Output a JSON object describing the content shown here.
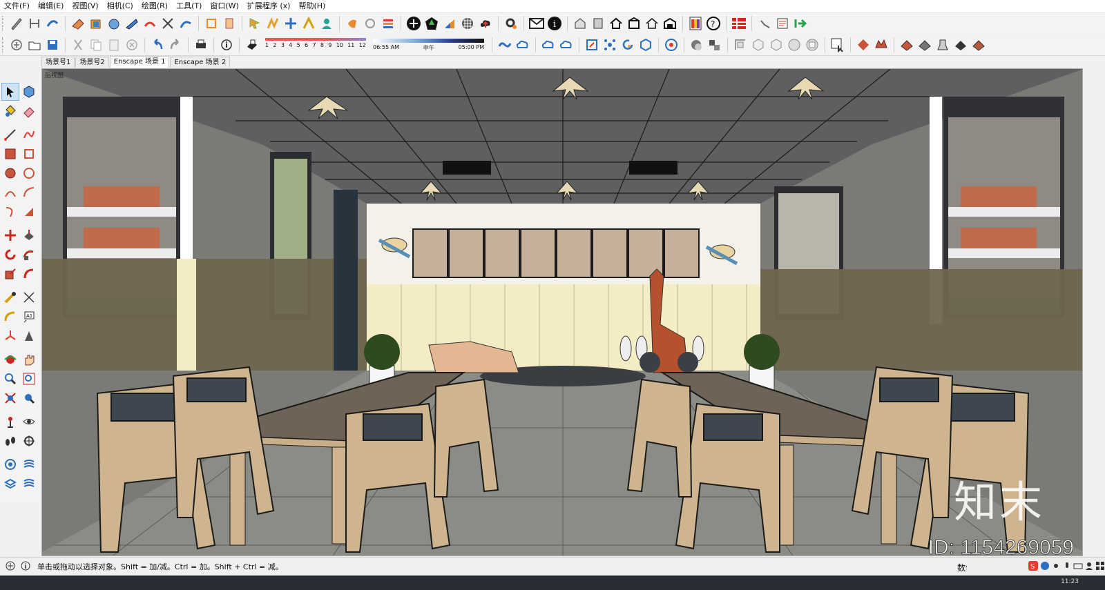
{
  "menu": [
    "文件(F)",
    "编辑(E)",
    "视图(V)",
    "相机(C)",
    "绘图(R)",
    "工具(T)",
    "窗口(W)",
    "扩展程序 (x)",
    "帮助(H)"
  ],
  "shadow": {
    "months": [
      "1",
      "2",
      "3",
      "4",
      "5",
      "6",
      "7",
      "8",
      "9",
      "10",
      "11",
      "12"
    ],
    "time_start": "06:55 AM",
    "time_mid": "中午",
    "time_end": "05:00 PM"
  },
  "scenes": [
    "场景号1",
    "场景号2",
    "Enscape 场景 1",
    "Enscape 场景 2"
  ],
  "active_scene_index": 2,
  "viewport": {
    "view_label": "后视图"
  },
  "watermark": {
    "logo": "知末",
    "id": "ID: 1154269059"
  },
  "status": {
    "hint": "单击或拖动以选择对象。Shift = 加/减。Ctrl = 加。Shift + Ctrl = 减。",
    "measure_label": "数值",
    "clock": "11:23"
  },
  "colors": {
    "accent": "#e23a2e",
    "toolbar_blue": "#2d6fbf",
    "select": "#cfe3f7"
  },
  "icons": {
    "toolbar1": [
      "pencil-icon",
      "dimension-icon",
      "follow-me-icon",
      "eraser-icon",
      "box-icon",
      "sphere-icon",
      "tape-icon",
      "arc-icon",
      "scissors-icon",
      "sandbox-icon",
      "section-icon",
      "section-plane-icon",
      "pointer-arrow-icon",
      "path-icon",
      "move-icon",
      "ruler-icon",
      "user-icon",
      "component-icon",
      "refresh-icon",
      "layers-icon",
      "add-circle-icon",
      "tree-icon",
      "flags-icon",
      "checker-icon",
      "cloud-upload-icon",
      "settings-icon",
      "mail-icon",
      "info-icon",
      "house-3d-icon",
      "book-icon",
      "home-icon",
      "building-icon",
      "home-outline-icon",
      "warehouse-icon",
      "material-icon",
      "help-icon",
      "layout-icon",
      "undo-icon",
      "notes-icon",
      "export-icon"
    ],
    "toolbar2": [
      "new-icon",
      "open-icon",
      "save-icon",
      "cut-icon",
      "copy-icon",
      "paste-icon",
      "delete-icon",
      "undo-icon",
      "redo-icon",
      "print-icon",
      "model-info-icon",
      "shadow-toggle-icon",
      "link-icon",
      "cloud-link-icon",
      "cloud-icon",
      "cloud-outline-icon",
      "scale-icon",
      "network-icon",
      "rotate-icon",
      "cube-icon",
      "chrome-icon",
      "orbit-icon",
      "texture-icon",
      "iso-view-icon",
      "top-view-icon",
      "front-view-icon",
      "right-view-icon",
      "back-view-icon",
      "left-view-icon",
      "xray-icon",
      "select-hand-icon",
      "paint-icon",
      "terrain-icon",
      "mesh-icon",
      "stamp-icon",
      "drape-icon",
      "flip-icon",
      "smooth-icon"
    ]
  }
}
